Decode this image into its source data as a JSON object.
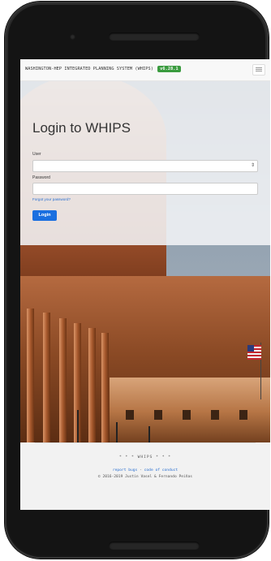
{
  "navbar": {
    "brand": "WASHINGTON-HEP INTEGRATED PLANNING SYSTEM (WHIPS)",
    "version": "v6.28.1",
    "menu_icon": "hamburger-icon"
  },
  "login": {
    "title": "Login to WHIPS",
    "user_label": "User",
    "user_value": "",
    "password_label": "Password",
    "password_value": "",
    "forgot_link": "Forgot your password?",
    "submit_label": "Login"
  },
  "footer": {
    "title": "* * * WHIPS * * *",
    "report_bugs": "report bugs",
    "separator": "·",
    "code_of_conduct": "code of conduct",
    "copyright": "© 2016-2019 Justin Vasel & Fernando Peiñas"
  },
  "colors": {
    "badge": "#3a9b3f",
    "primary_button": "#1a6fe0",
    "link": "#2a6fd0"
  }
}
